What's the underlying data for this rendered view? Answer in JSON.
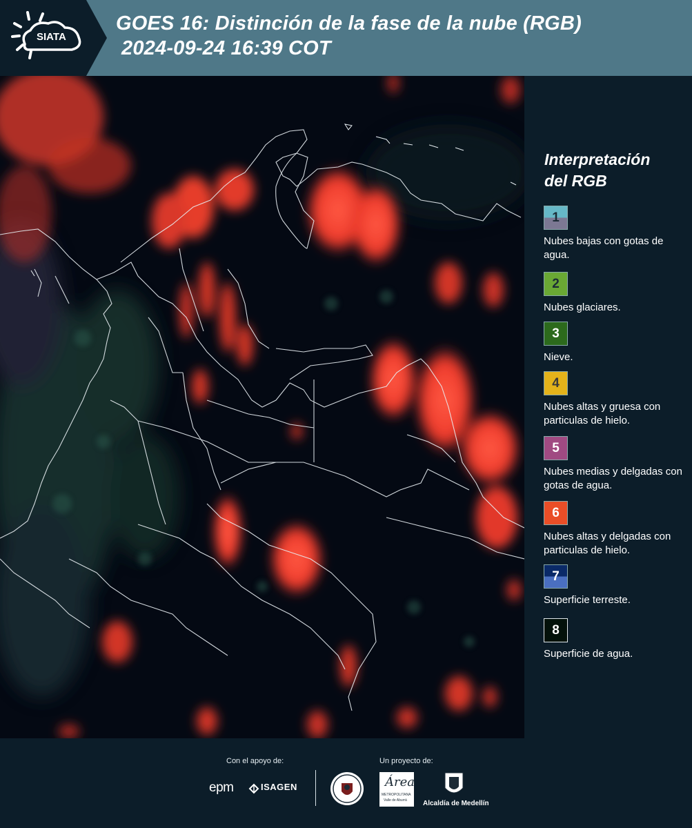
{
  "header": {
    "logo_text": "SIATA",
    "title_line1": "GOES 16: Distinción de la fase de la nube (RGB)",
    "title_line2": "2024-09-24 16:39 COT"
  },
  "legend": {
    "title_line1": "Interpretación",
    "title_line2": "del RGB",
    "items": [
      {
        "num": "1",
        "desc": "Nubes bajas con gotas de agua.",
        "color": "#66b8c7",
        "color2": "#7c7893"
      },
      {
        "num": "2",
        "desc": "Nubes glaciares.",
        "color": "#6aa834"
      },
      {
        "num": "3",
        "desc": "Nieve.",
        "color": "#2c6a1c"
      },
      {
        "num": "4",
        "desc": "Nubes altas y gruesa con particulas de hielo.",
        "color": "#e4b31a"
      },
      {
        "num": "5",
        "desc": "Nubes medias y delgadas con gotas de agua.",
        "color": "#a04a82"
      },
      {
        "num": "6",
        "desc": "Nubes altas y delgadas con particulas de hielo.",
        "color": "#ea4e27"
      },
      {
        "num": "7",
        "desc": "Superficie terreste.",
        "color": "#0a2a68",
        "color2": "#4a6fc0"
      },
      {
        "num": "8",
        "desc": "Superficie de agua.",
        "color": "#03110a"
      }
    ]
  },
  "footer": {
    "support_label": "Con el apoyo de:",
    "project_label": "Un proyecto de:",
    "epm_text": "epm",
    "isagen_text": "ISAGEN",
    "area_text": "Área",
    "area_sub1": "METROPOLITANA",
    "area_sub2": "Valle de Aburrá",
    "alcaldia_text": "Alcaldía de Medellín"
  }
}
